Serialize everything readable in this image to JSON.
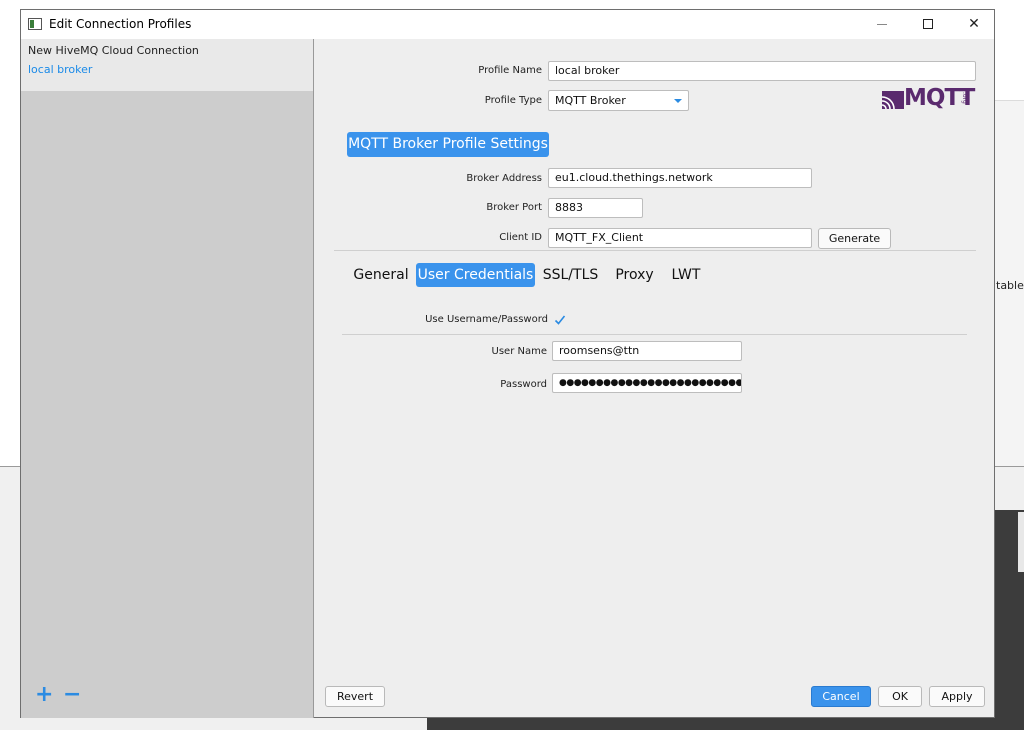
{
  "dialog": {
    "title": "Edit Connection Profiles"
  },
  "window_controls": {
    "minimize": "—",
    "close": "✕"
  },
  "profiles": [
    {
      "label": "New HiveMQ Cloud Connection",
      "selected": false
    },
    {
      "label": "local broker",
      "selected": true
    }
  ],
  "profile_list_actions": {
    "add": "+",
    "remove": "−"
  },
  "profile": {
    "name_label": "Profile Name",
    "name_value": "local broker",
    "type_label": "Profile Type",
    "type_value": "MQTT Broker"
  },
  "logo": {
    "text": "MQTT",
    "small_text": ".org"
  },
  "section_title": "MQTT Broker Profile Settings",
  "broker": {
    "address_label": "Broker Address",
    "address_value": "eu1.cloud.thethings.network",
    "port_label": "Broker Port",
    "port_value": "8883",
    "client_id_label": "Client ID",
    "client_id_value": "MQTT_FX_Client",
    "generate_label": "Generate"
  },
  "tabs": [
    {
      "label": "General",
      "active": false
    },
    {
      "label": "User Credentials",
      "active": true
    },
    {
      "label": "SSL/TLS",
      "active": false
    },
    {
      "label": "Proxy",
      "active": false
    },
    {
      "label": "LWT",
      "active": false
    }
  ],
  "credentials": {
    "use_label": "Use Username/Password",
    "use_checked": true,
    "username_label": "User Name",
    "username_value": "roomsens@ttn",
    "password_label": "Password",
    "password_mask": "●●●●●●●●●●●●●●●●●●●●●●●●●●"
  },
  "footer": {
    "revert": "Revert",
    "cancel": "Cancel",
    "ok": "OK",
    "apply": "Apply"
  },
  "background": {
    "partial_text": "table"
  },
  "colors": {
    "accent": "#3a93ec",
    "link": "#1a8ae8",
    "logo": "#5a2a6e"
  }
}
